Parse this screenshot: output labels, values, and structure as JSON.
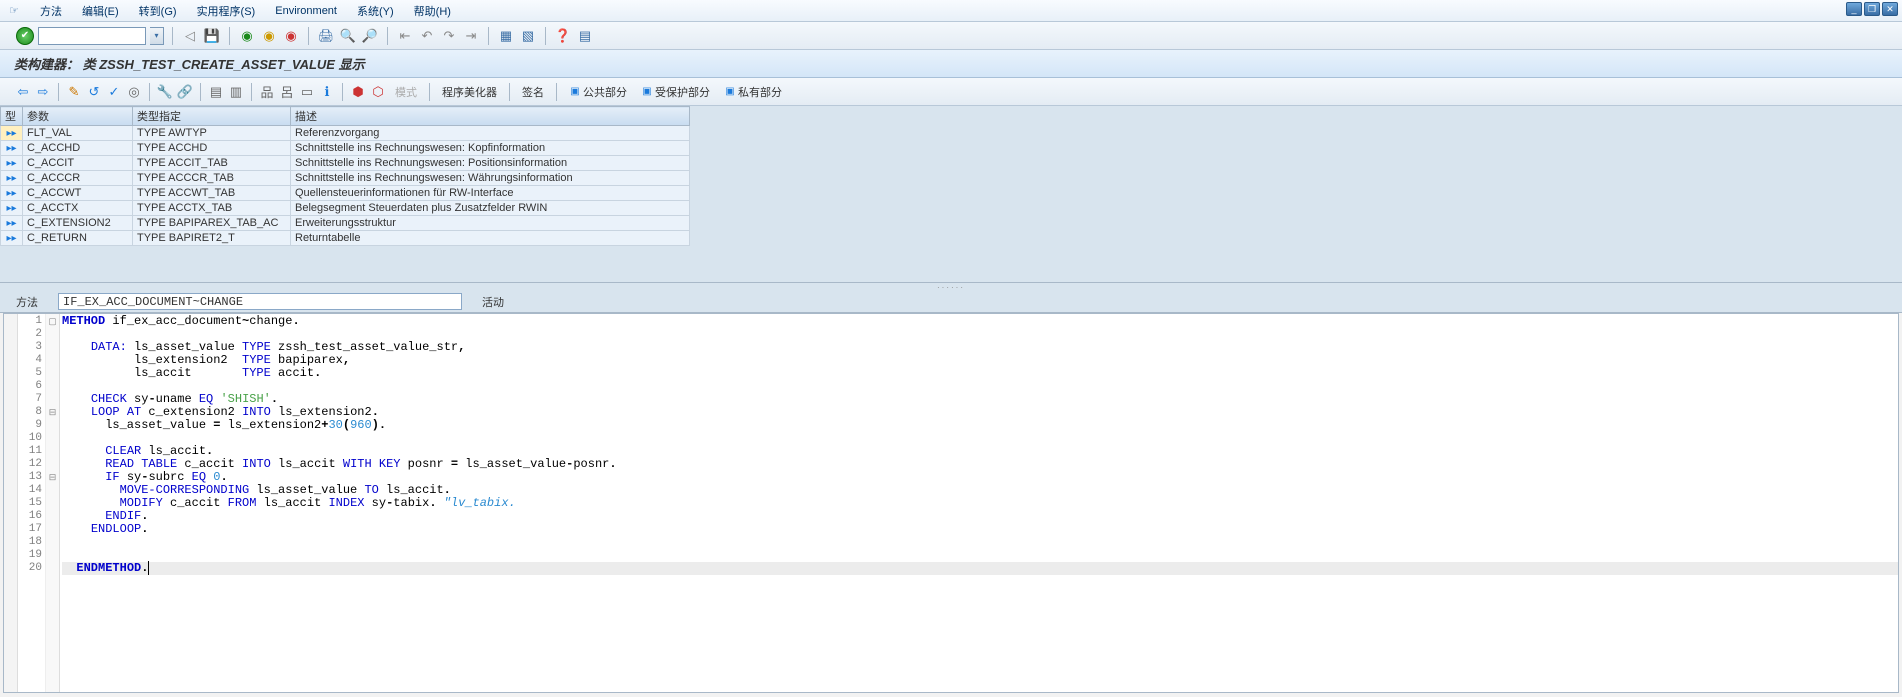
{
  "menu": {
    "method": "方法",
    "edit": "编辑(E)",
    "goto": "转到(G)",
    "util": "实用程序(S)",
    "env": "Environment",
    "system": "系统(Y)",
    "help": "帮助(H)"
  },
  "title": "类构建器：  类 ZSSH_TEST_CREATE_ASSET_VALUE 显示",
  "apptb": {
    "mode": "模式",
    "pretty": "程序美化器",
    "sign": "签名",
    "public": "公共部分",
    "protected": "受保护部分",
    "private": "私有部分"
  },
  "table": {
    "h_type": "型",
    "h_param": "参数",
    "h_typing": "类型指定",
    "h_desc": "描述",
    "rows": [
      {
        "p": "FLT_VAL",
        "t": "TYPE AWTYP",
        "d": "Referenzvorgang",
        "sel": true
      },
      {
        "p": "C_ACCHD",
        "t": "TYPE ACCHD",
        "d": "Schnittstelle ins Rechnungswesen: Kopfinformation"
      },
      {
        "p": "C_ACCIT",
        "t": "TYPE ACCIT_TAB",
        "d": "Schnittstelle ins Rechnungswesen: Positionsinformation"
      },
      {
        "p": "C_ACCCR",
        "t": "TYPE ACCCR_TAB",
        "d": "Schnittstelle ins Rechnungswesen: Währungsinformation"
      },
      {
        "p": "C_ACCWT",
        "t": "TYPE ACCWT_TAB",
        "d": "Quellensteuerinformationen für RW-Interface"
      },
      {
        "p": "C_ACCTX",
        "t": "TYPE ACCTX_TAB",
        "d": "Belegsegment Steuerdaten plus Zusatzfelder RWIN"
      },
      {
        "p": "C_EXTENSION2",
        "t": "TYPE BAPIPAREX_TAB_AC",
        "d": "Erweiterungsstruktur"
      },
      {
        "p": "C_RETURN",
        "t": "TYPE BAPIRET2_T",
        "d": "Returntabelle"
      }
    ]
  },
  "method_label": "方法",
  "method_value": "IF_EX_ACC_DOCUMENT~CHANGE",
  "status_label": "活动",
  "code": {
    "lines": [
      {
        "n": 1,
        "fold": "▢",
        "html": "<span class='kw bold'>METHOD</span> if_ex_acc_document<span class='bold'>~</span>change<span class='bold'>.</span>"
      },
      {
        "n": 2,
        "html": ""
      },
      {
        "n": 3,
        "html": "    <span class='kw'>DATA:</span> ls_asset_value <span class='kw'>TYPE</span> zssh_test_asset_value_str<span class='bold'>,</span>"
      },
      {
        "n": 4,
        "html": "          ls_extension2  <span class='kw'>TYPE</span> bapiparex<span class='bold'>,</span>"
      },
      {
        "n": 5,
        "html": "          ls_accit       <span class='kw'>TYPE</span> accit<span class='bold'>.</span>"
      },
      {
        "n": 6,
        "html": ""
      },
      {
        "n": 7,
        "html": "    <span class='kw'>CHECK</span> sy<span class='bold'>-</span>uname <span class='kw'>EQ</span> <span class='str'>'SHISH'</span><span class='bold'>.</span>"
      },
      {
        "n": 8,
        "fold": "⊟",
        "html": "    <span class='kw'>LOOP AT</span> c_extension2 <span class='kw'>INTO</span> ls_extension2<span class='bold'>.</span>"
      },
      {
        "n": 9,
        "html": "      ls_asset_value <span class='bold'>=</span> ls_extension2<span class='bold'>+</span><span class='num'>30</span><span class='bold'>(</span><span class='num'>960</span><span class='bold'>).</span>"
      },
      {
        "n": 10,
        "html": ""
      },
      {
        "n": 11,
        "html": "      <span class='kw'>CLEAR</span> ls_accit<span class='bold'>.</span>"
      },
      {
        "n": 12,
        "html": "      <span class='kw'>READ TABLE</span> c_accit <span class='kw'>INTO</span> ls_accit <span class='kw'>WITH KEY</span> posnr <span class='bold'>=</span> ls_asset_value<span class='bold'>-</span>posnr<span class='bold'>.</span>"
      },
      {
        "n": 13,
        "fold": "⊟",
        "html": "      <span class='kw'>IF</span> sy<span class='bold'>-</span>subrc <span class='kw'>EQ</span> <span class='num'>0</span><span class='bold'>.</span>"
      },
      {
        "n": 14,
        "html": "        <span class='kw'>MOVE-CORRESPONDING</span> ls_asset_value <span class='kw'>TO</span> ls_accit<span class='bold'>.</span>"
      },
      {
        "n": 15,
        "html": "        <span class='kw'>MODIFY</span> c_accit <span class='kw'>FROM</span> ls_accit <span class='kw'>INDEX</span> sy<span class='bold'>-</span>tabix<span class='bold'>.</span> <span class='cmt'>\"lv_tabix.</span>"
      },
      {
        "n": 16,
        "html": "      <span class='kw'>ENDIF</span><span class='bold'>.</span>"
      },
      {
        "n": 17,
        "html": "    <span class='kw'>ENDLOOP</span><span class='bold'>.</span>"
      },
      {
        "n": 18,
        "html": ""
      },
      {
        "n": 19,
        "html": ""
      },
      {
        "n": 20,
        "current": true,
        "html": "  <span class='kw bold'>ENDMETHOD</span><span class='bold'>.</span><span class='cursor'></span>"
      }
    ]
  }
}
